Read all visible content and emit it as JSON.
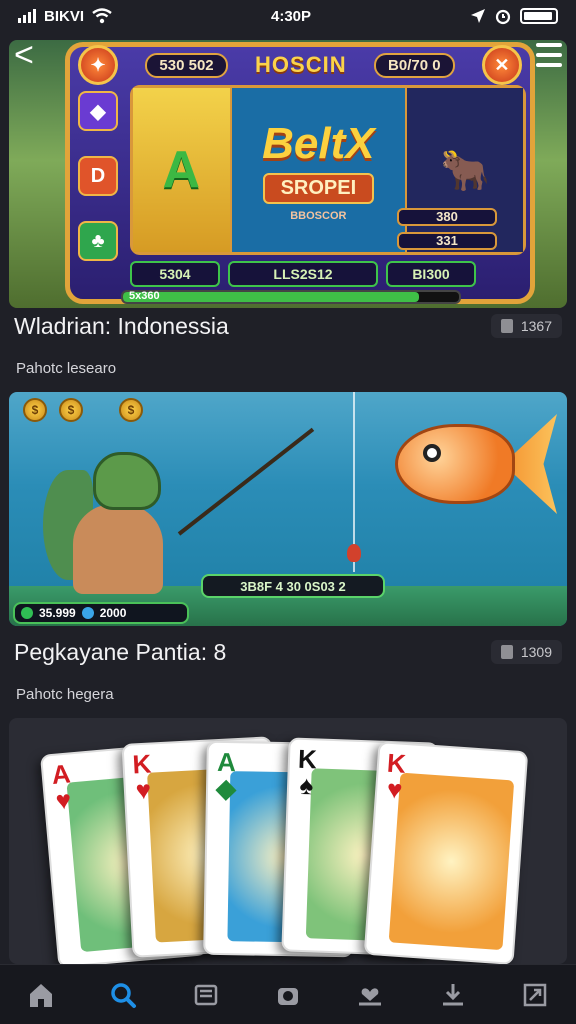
{
  "status": {
    "carrier": "BIKVI",
    "time": "4:30P"
  },
  "nav": {
    "back_label": "<"
  },
  "slot": {
    "title": "HOSCIN",
    "left_pill": "530 502",
    "right_pill": "B0/70 0",
    "reel_letter": "A",
    "logo_main": "BeltX",
    "logo_sub": "SROPEI",
    "reel_caption": "BBOSCOR",
    "bar_left": "5304",
    "bar_mid": "LLS2S12",
    "bar_right": "BI300",
    "side_values": [
      "380",
      "331"
    ],
    "progress_label": "5x360",
    "progress_fraction": 0.88
  },
  "items": [
    {
      "title": "Wladrian: Indonessia",
      "count": "1367",
      "subtitle": "Pahotc lesearo"
    },
    {
      "title": "Pegkayane Pantia: 8",
      "count": "1309",
      "subtitle": "Pahotc hegera"
    }
  ],
  "fishing": {
    "panel_text": "3B8F 4 30 0S03 2",
    "wallet_a": "35.999",
    "wallet_b": "2000"
  },
  "cards": [
    {
      "rank": "A",
      "suit": "♥",
      "color": "red",
      "art": "#6fbf7a"
    },
    {
      "rank": "K",
      "suit": "♥",
      "color": "red",
      "art": "#d7a640"
    },
    {
      "rank": "A",
      "suit": "◆",
      "color": "green",
      "art": "#3aa0d8"
    },
    {
      "rank": "K",
      "suit": "♠",
      "color": "black",
      "art": "#7fc37a"
    },
    {
      "rank": "K",
      "suit": "♥",
      "color": "red",
      "art": "#f2a03a"
    }
  ],
  "tabs": [
    "home-icon",
    "search-icon",
    "cards-icon",
    "camera-icon",
    "heart-hand-icon",
    "download-icon",
    "expand-icon"
  ],
  "colors": {
    "accent": "#1e8fe6",
    "background": "#1f2027"
  }
}
